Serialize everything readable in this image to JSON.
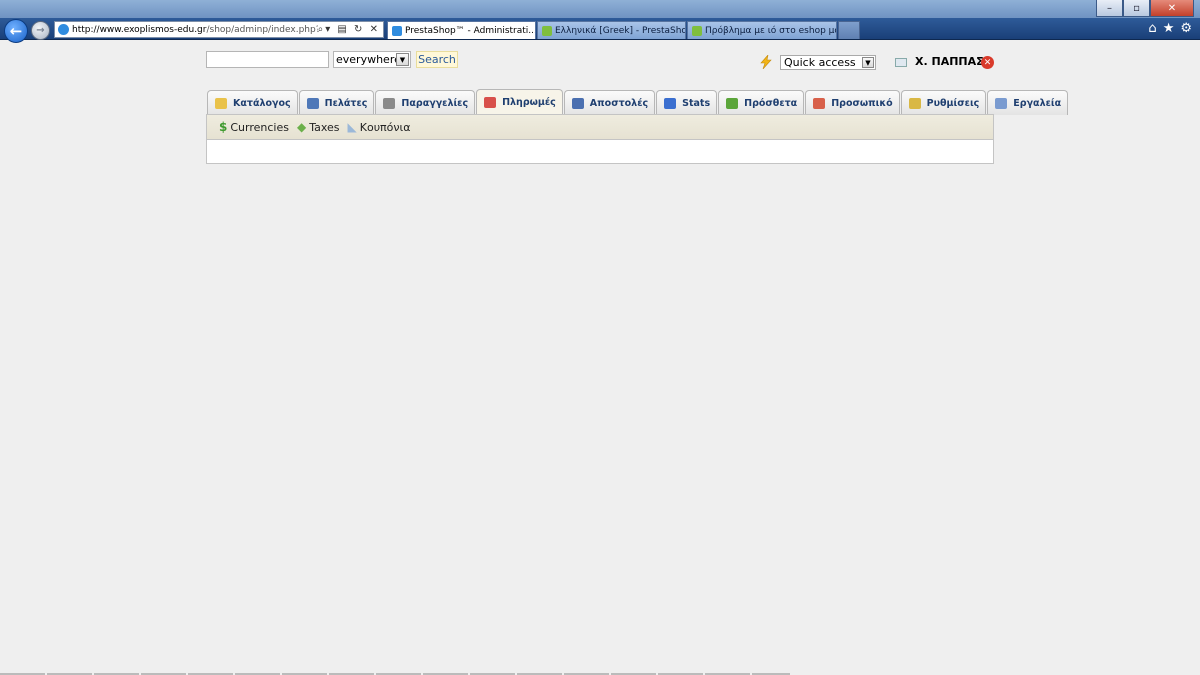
{
  "browser": {
    "address_url_host": "http://www.exoplismos-edu.gr",
    "address_url_path": "/shop/adminp/index.php?tab=",
    "tabs": [
      {
        "label": "PrestaShop™ - Administrati...",
        "favicon_color": "#2f8ce0"
      },
      {
        "label": "Ελληνικά [Greek] - PrestaShop ...",
        "favicon_color": "#7fbf3f"
      },
      {
        "label": "Πρόβλημα με ιό στο eshop μο...",
        "favicon_color": "#7fbf3f"
      }
    ],
    "tab_close": "×"
  },
  "search": {
    "value": "",
    "scope_selected": "everywhere",
    "button_label": "Search"
  },
  "header": {
    "quick_access_selected": "Quick access",
    "user_name": "Χ. ΠΑΠΠΑΣ"
  },
  "main_tabs": [
    {
      "label": "Κατάλογος",
      "icon": "folder-icon",
      "color": "#e9c24a"
    },
    {
      "label": "Πελάτες",
      "icon": "customer-icon",
      "color": "#4f78b8"
    },
    {
      "label": "Παραγγελίες",
      "icon": "orders-icon",
      "color": "#8a8a8a"
    },
    {
      "label": "Πληρωμές",
      "icon": "payment-icon",
      "color": "#d8504a"
    },
    {
      "label": "Αποστολές",
      "icon": "truck-icon",
      "color": "#4a6fb0"
    },
    {
      "label": "Stats",
      "icon": "chart-icon",
      "color": "#3b6fd0"
    },
    {
      "label": "Πρόσθετα",
      "icon": "puzzle-icon",
      "color": "#5ba53a"
    },
    {
      "label": "Προσωπικό",
      "icon": "staff-icon",
      "color": "#d8604a"
    },
    {
      "label": "Ρυθμίσεις",
      "icon": "settings-icon",
      "color": "#d9b845"
    },
    {
      "label": "Εργαλεία",
      "icon": "tools-icon",
      "color": "#7a9bd0"
    }
  ],
  "active_tab_index": 3,
  "sub_tabs": [
    {
      "label": "Currencies",
      "icon": "dollar-icon",
      "glyph": "$",
      "color": "#3f9a2f"
    },
    {
      "label": "Taxes",
      "icon": "money-icon",
      "glyph": "◆",
      "color": "#6bb04a"
    },
    {
      "label": "Κουπόνια",
      "icon": "tag-icon",
      "glyph": "◣",
      "color": "#9bb8d8"
    }
  ]
}
